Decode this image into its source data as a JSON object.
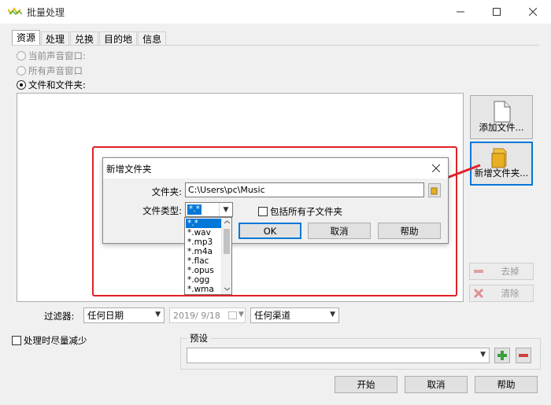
{
  "window": {
    "title": "批量处理",
    "minimize_icon": "minimize-icon",
    "maximize_icon": "maximize-icon",
    "close_icon": "close-icon"
  },
  "tabs": [
    {
      "label": "资源",
      "active": true
    },
    {
      "label": "处理"
    },
    {
      "label": "兑换"
    },
    {
      "label": "目的地"
    },
    {
      "label": "信息"
    }
  ],
  "sources": {
    "radio_current": "当前声音窗口:",
    "radio_all": "所有声音窗口",
    "radio_files": "文件和文件夹:"
  },
  "side_buttons": {
    "add_files": "添加文件...",
    "new_folder": "新增文件夹...",
    "remove": "去掉",
    "clear": "清除"
  },
  "dialog": {
    "title": "新增文件夹",
    "folder_label": "文件夹:",
    "folder_value": "C:\\Users\\pc\\Music",
    "filetype_label": "文件类型:",
    "filetype_selected": "*.*",
    "include_subfolders": "包括所有子文件夹",
    "ok": "OK",
    "cancel": "取消",
    "help": "帮助",
    "filetype_options": [
      "*.*",
      "*.wav",
      "*.mp3",
      "*.m4a",
      "*.flac",
      "*.opus",
      "*.ogg",
      "*.wma"
    ]
  },
  "filters": {
    "label": "过滤器:",
    "date_option": "任何日期",
    "date_value": "2019/ 9/18",
    "channel_option": "任何渠道"
  },
  "bottom": {
    "minimize_checkbox": "处理时尽量减少",
    "presets_label": "预设",
    "preset_value": "",
    "start": "开始",
    "cancel": "取消",
    "help": "帮助"
  },
  "colors": {
    "accent": "#0078d7",
    "annotation": "#e0202a",
    "add_green": "#3aa03a",
    "remove_red": "#d23c3c"
  }
}
